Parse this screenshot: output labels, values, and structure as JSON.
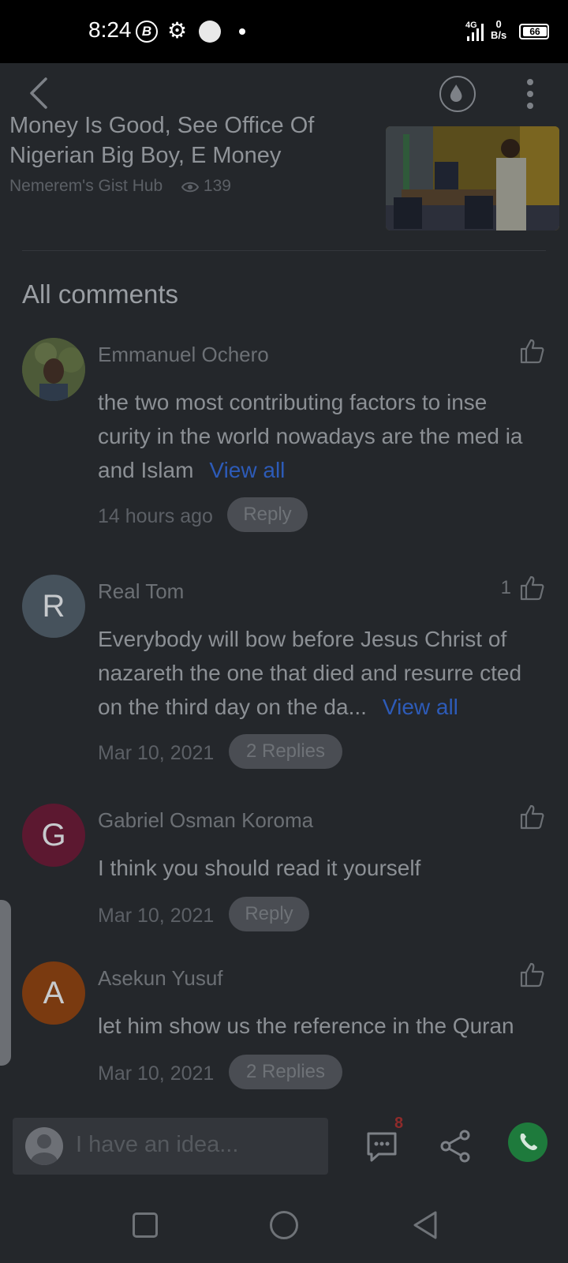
{
  "status_bar": {
    "time": "8:24",
    "b_icon_label": "B",
    "network_label_top": "0",
    "network_label_bottom": "B/s",
    "signal_label": "4G",
    "battery": "66"
  },
  "article": {
    "title": "Money Is Good, See Office Of Nigerian Big Boy, E Money",
    "source": "Nemerem's Gist Hub",
    "views": "139"
  },
  "comments_section": {
    "title": "All comments",
    "view_all_label": "View all",
    "items": [
      {
        "author": "Emmanuel Ochero",
        "avatar_letter": "",
        "likes": "",
        "text": "the two most contributing factors to inse curity in the world  nowadays are the med ia and Islam",
        "date": "14 hours ago",
        "reply_label": "Reply"
      },
      {
        "author": "Real Tom",
        "avatar_letter": "R",
        "avatar_color": "#4a5866",
        "likes": "1",
        "text": "Everybody will bow before Jesus Christ of nazareth the one that died and resurre cted on the third day on the da...",
        "date": "Mar 10, 2021",
        "reply_label": "2 Replies"
      },
      {
        "author": "Gabriel Osman Koroma",
        "avatar_letter": "G",
        "avatar_color": "#6d1532",
        "likes": "",
        "text": "I think you should read it yourself",
        "date": "Mar 10, 2021",
        "reply_label": "Reply"
      },
      {
        "author": "Asekun Yusuf",
        "avatar_letter": "A",
        "avatar_color": "#8b400e",
        "likes": "",
        "text": "let him show us the reference in the Quran",
        "date": "Mar 10, 2021",
        "reply_label": "2 Replies"
      }
    ]
  },
  "bottom_bar": {
    "placeholder": "I have an idea...",
    "comment_count": "8"
  },
  "icons": {
    "back": "back-arrow-icon",
    "theme": "water-drop-icon",
    "more": "more-vertical-icon",
    "like": "thumbs-up-icon",
    "comments": "comment-bubble-icon",
    "share": "share-icon",
    "whatsapp": "whatsapp-icon"
  }
}
